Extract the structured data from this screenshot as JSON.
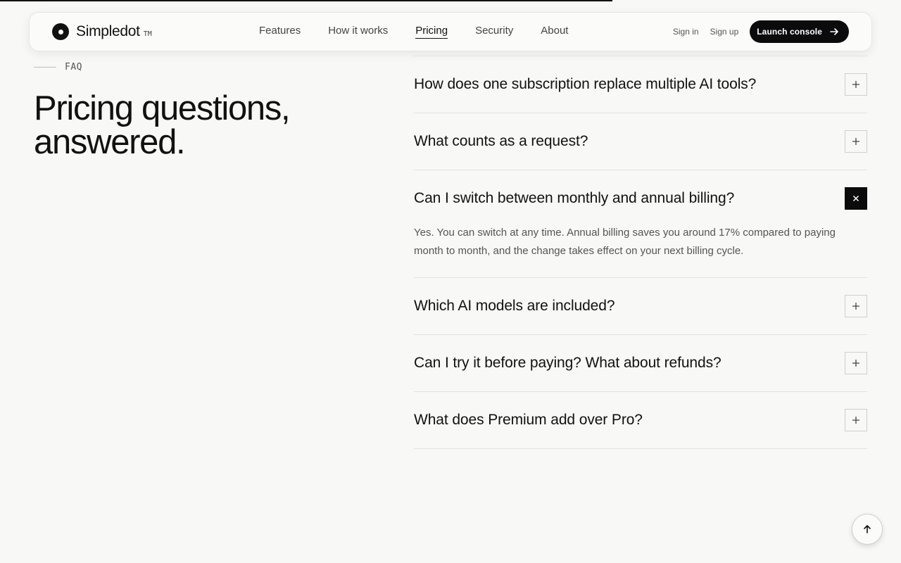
{
  "scroll_progress": 0.68,
  "brand": {
    "name": "Simpledot",
    "tm": "TM"
  },
  "nav": {
    "links": [
      "Features",
      "How it works",
      "Pricing",
      "Security",
      "About"
    ],
    "active": "Pricing"
  },
  "auth": {
    "sign_in": "Sign in",
    "sign_up": "Sign up",
    "launch": "Launch console"
  },
  "faq": {
    "eyebrow": "FAQ",
    "title": "Pricing questions, answered.",
    "items": [
      {
        "question": "How does one subscription replace multiple AI tools?",
        "open": false,
        "answer": ""
      },
      {
        "question": "What counts as a request?",
        "open": false,
        "answer": ""
      },
      {
        "question": "Can I switch between monthly and annual billing?",
        "open": true,
        "answer": "Yes. You can switch at any time. Annual billing saves you around 17% compared to paying month to month, and the change takes effect on your next billing cycle."
      },
      {
        "question": "Which AI models are included?",
        "open": false,
        "answer": ""
      },
      {
        "question": "Can I try it before paying? What about refunds?",
        "open": false,
        "answer": ""
      },
      {
        "question": "What does Premium add over Pro?",
        "open": false,
        "answer": ""
      }
    ]
  },
  "icons": {
    "toggle_closed": "plus-icon",
    "toggle_open": "close-icon",
    "launch": "arrow-right-icon",
    "back_to_top": "arrow-up-icon"
  }
}
